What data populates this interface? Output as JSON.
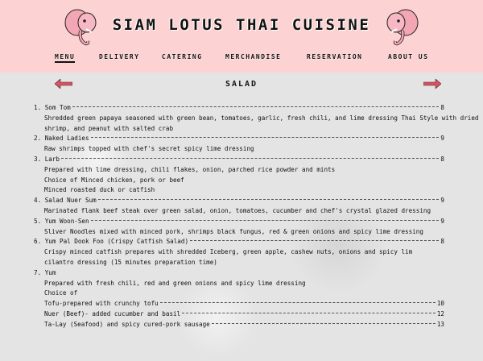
{
  "header": {
    "title": "SIAM LOTUS THAI CUISINE",
    "logo_icon": "pink-elephant-icon"
  },
  "nav": {
    "items": [
      {
        "label": "MENU",
        "active": true
      },
      {
        "label": "DELIVERY",
        "active": false
      },
      {
        "label": "CATERING",
        "active": false
      },
      {
        "label": "MERCHANDISE",
        "active": false
      },
      {
        "label": "RESERVATION",
        "active": false
      },
      {
        "label": "ABOUT US",
        "active": false
      }
    ]
  },
  "section": {
    "title": "SALAD",
    "prev_icon": "arrow-left-icon",
    "next_icon": "arrow-right-icon"
  },
  "menu_items": [
    {
      "name": "1. Som Tom",
      "price": "8",
      "lines": [
        "Shredded green papaya seasoned with green bean, tomatoes, garlic, fresh chili, and lime dressing Thai Style with dried",
        "shrimp, and peanut with salted crab"
      ]
    },
    {
      "name": "2. Naked Ladies",
      "price": "9",
      "lines": [
        "Raw shrimps topped with chef's secret spicy lime dressing"
      ]
    },
    {
      "name": "3. Larb",
      "price": "8",
      "lines": [
        "Prepared with lime dressing, chili flakes, onion, parched rice powder and mints",
        "Choice of Minced chicken, pork or beef",
        "Minced roasted duck or catfish"
      ]
    },
    {
      "name": "4. Salad Nuer Sum",
      "price": "9",
      "lines": [
        "Marinated flank beef steak over green salad, onion, tomatoes, cucumber and chef's crystal glazed dressing"
      ]
    },
    {
      "name": "5. Yum Woon-Sen",
      "price": "9",
      "lines": [
        "Sliver Noodles mixed with minced pork, shrimps black fungus, red & green onions and spicy lime dressing"
      ]
    },
    {
      "name": "6. Yum Pal Dook Foo (Crispy Catfish Salad)",
      "price": "8",
      "lines": [
        "Crispy minced catfish prepares with shredded Iceberg, green apple, cashew nuts, onions and spicy lim",
        "cilantro dressing (15 minutes preparation time)"
      ]
    },
    {
      "name": "7. Yum",
      "price": "",
      "lines": [
        "Prepared with fresh chili, red and green onions and spicy lime dressing",
        "Choice of"
      ],
      "options": [
        {
          "name": "Tofu-prepared with crunchy tofu",
          "price": "10"
        },
        {
          "name": "Nuer (Beef)- added cucumber and basil",
          "price": "12"
        },
        {
          "name": "Ta-Lay (Seafood) and spicy cured-pork sausage",
          "price": "13"
        }
      ]
    }
  ],
  "colors": {
    "header_bg": "#fcd2d2",
    "accent": "#e05060",
    "text": "#111111"
  }
}
